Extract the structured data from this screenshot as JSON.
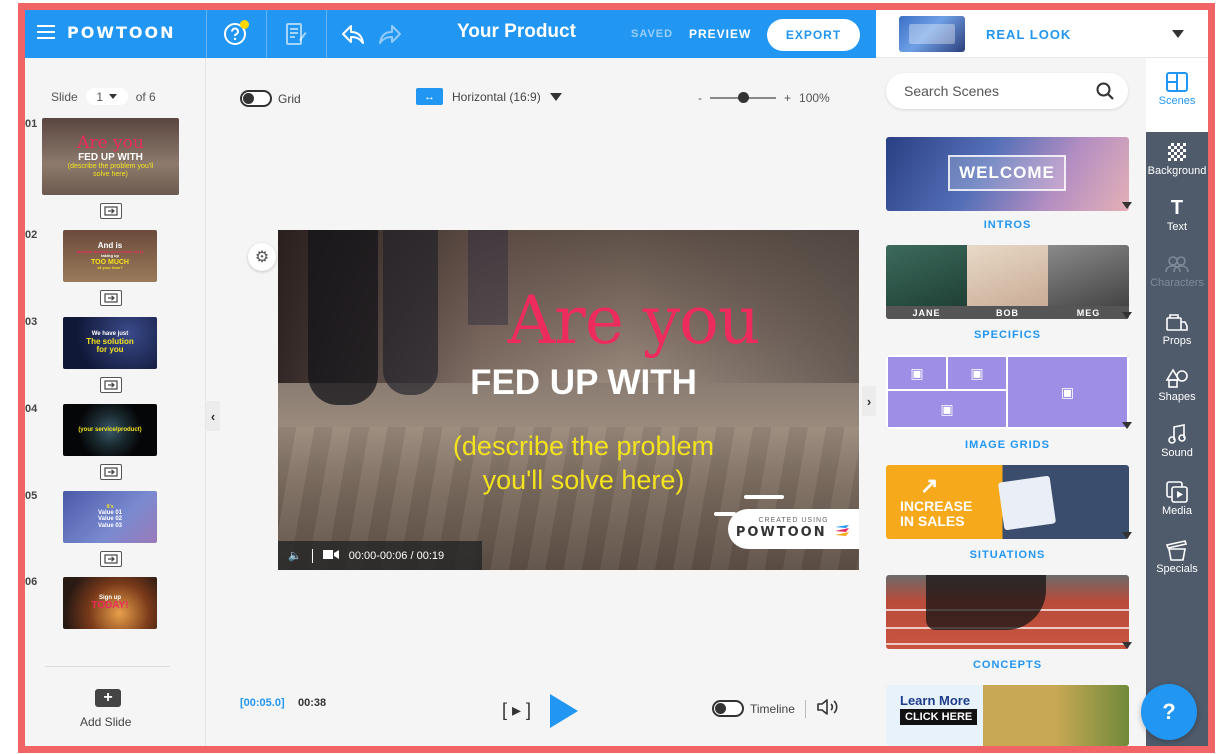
{
  "app": {
    "logo": "POWTOON",
    "title": "Your Product",
    "saved_label": "SAVED",
    "preview_label": "PREVIEW",
    "export_label": "EXPORT"
  },
  "theme": {
    "name": "REAL LOOK"
  },
  "slides_panel": {
    "slide_label": "Slide",
    "current_slide": "1",
    "of_label": "of 6",
    "add_slide_label": "Add Slide",
    "slides": [
      {
        "index": "01",
        "lines": [
          "Are you",
          "FED UP WITH",
          "(describe the problem you'll solve here)"
        ]
      },
      {
        "index": "02",
        "lines": [
          "And is",
          "(another problem you'll solve here)",
          "taking up",
          "TOO MUCH",
          "of your time?"
        ]
      },
      {
        "index": "03",
        "lines": [
          "We have just",
          "The solution",
          "for you"
        ]
      },
      {
        "index": "04",
        "lines": [
          "(your service/product)"
        ]
      },
      {
        "index": "05",
        "lines": [
          "It's",
          "Value 01",
          "Value 02",
          "Value 03"
        ]
      },
      {
        "index": "06",
        "lines": [
          "Sign up",
          "TODAY!"
        ]
      }
    ]
  },
  "toolbar": {
    "grid_label": "Grid",
    "orientation_label": "Horizontal (16:9)",
    "zoom_minus": "-",
    "zoom_plus": "+",
    "zoom_level": "100%",
    "zoom_value": 0.5
  },
  "stage": {
    "line1": "Are you",
    "line2": "FED UP WITH",
    "line3a": "(describe the problem",
    "line3b": "you'll solve here)",
    "badge_small": "CREATED USING",
    "badge_big": "POWTOON",
    "time_range": "00:00-00:06 / 00:19"
  },
  "playback": {
    "current_time": "[00:05.0]",
    "total_time": "00:38",
    "frame_step": "[ ▸ ]",
    "timeline_label": "Timeline"
  },
  "scenes_panel": {
    "search_placeholder": "Search Scenes",
    "categories": [
      {
        "label": "INTROS",
        "card_text": "WELCOME"
      },
      {
        "label": "SPECIFICS",
        "faces": [
          "JANE",
          "BOB",
          "MEG"
        ]
      },
      {
        "label": "IMAGE GRIDS"
      },
      {
        "label": "SITUATIONS",
        "card_text": [
          "INCREASE",
          "IN SALES"
        ]
      },
      {
        "label": "CONCEPTS"
      },
      {
        "label": "",
        "card_text": [
          "Learn More",
          "CLICK HERE"
        ]
      }
    ]
  },
  "icon_sidebar": [
    {
      "label": "Scenes",
      "icon": "layout-icon"
    },
    {
      "label": "Background",
      "icon": "checker-icon"
    },
    {
      "label": "Text",
      "icon": "text-icon"
    },
    {
      "label": "Characters",
      "icon": "characters-icon"
    },
    {
      "label": "Props",
      "icon": "props-icon"
    },
    {
      "label": "Shapes",
      "icon": "shapes-icon"
    },
    {
      "label": "Sound",
      "icon": "music-note-icon"
    },
    {
      "label": "Media",
      "icon": "media-icon"
    },
    {
      "label": "Specials",
      "icon": "specials-icon"
    }
  ],
  "help_fab": "?",
  "colors": {
    "accent": "#2196f3",
    "frame_border": "#f06466",
    "headline_pink": "#ed2b5d",
    "subtitle_yellow": "#f3e21e",
    "sidebar_dark": "#4f5b6b"
  }
}
